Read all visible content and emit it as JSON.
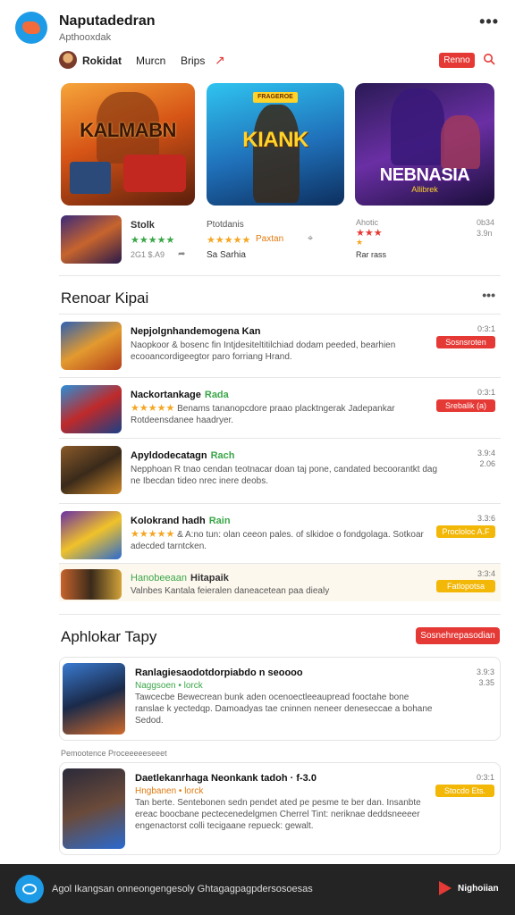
{
  "header": {
    "title": "Naputadedran",
    "subtitle": "Apthooxdak",
    "more_label": "•••"
  },
  "tabs": {
    "items": [
      "Rokidat",
      "Murcn",
      "Brips"
    ],
    "action_button": "Renno"
  },
  "featured": [
    {
      "title": "KALMABN"
    },
    {
      "title": "KIANK",
      "badge": "FRAGEROE"
    },
    {
      "title": "NEBNASIA",
      "subtitle": "Allibrek"
    }
  ],
  "mini_row": {
    "item1": {
      "title": "Stolk",
      "meta": "2G1 $.A9",
      "stars": "★★★★★"
    },
    "item2": {
      "title": "Ptotdanis",
      "stars": "★★★★★",
      "tag": "Paxtan",
      "meta": "Sa Sarhia"
    },
    "item3": {
      "title": "Ahotic",
      "stars": "★★★",
      "meta": "Rar rass",
      "extra": "★"
    },
    "meta_right": {
      "line1": "0b34",
      "line2": "3.9n"
    }
  },
  "section1": {
    "title": "Renoar Kipai",
    "more": "•••",
    "rows": [
      {
        "title": "Nepjolgnhandemogena Kan",
        "tag": "",
        "desc": "Naopkoor & bosenc fin Intjdesiteltitilchiad dodam peeded, bearhien ecooancordigeegtor paro forriang Hrand.",
        "meta": "0:3:1",
        "button": "Sosnsroten",
        "btn_color": "red"
      },
      {
        "title": "Nackortankage",
        "tag": "Rada",
        "stars": "★★★★★",
        "desc": "Benams tananopcdore praao placktngerak Jadepankar Rotdeensdanee haadryer.",
        "meta": "0:3:1",
        "button": "Srebalik (a)",
        "btn_color": "red"
      },
      {
        "title": "Apyldodecatagn",
        "tag": "Rach",
        "desc": "Nepphoan R tnao cendan teotnacar doan taj pone, candated becoorantkt dag ne Ibecdan tideo nrec inere deobs.",
        "meta": "3.9:4 2.06",
        "button": "",
        "btn_color": ""
      },
      {
        "title": "Kolokrand hadh",
        "tag": "Rain",
        "stars": "★★★★★",
        "desc": "& A:no tun: olan ceeon pales. of slkidoe o fondgolaga. Sotkoar adecded tarntcken.",
        "meta": "3.3:6",
        "button": "Procloloc A.F",
        "btn_color": "yellow"
      },
      {
        "title": "Hanobeeaan",
        "tag": "Hitapaik",
        "desc": "Valnbes Kantala feieralen daneacetean paa diealy",
        "meta": "3:3:4",
        "button": "Fatlopotsa",
        "btn_color": "yellow"
      }
    ]
  },
  "section2": {
    "title": "Aphlokar Tapy",
    "button": "Sosnehrepasodian",
    "cards": [
      {
        "title": "Ranlagiesaodotdorpiabdo n seoooo",
        "sub": "Naggsoen • lorck",
        "desc": "Tawcecbe Bewecrean bunk aden ocenoectleeaupread fooctahe bone ranslae k yectedqp. Damoadyas tae cninnen neneer deneseccae a bohane Sedod.",
        "meta": "3.9:3 3.35",
        "button": ""
      },
      {
        "title": "Daetlekanrhaga Neonkank tadoh · f-3.0",
        "sub": "Hngbanen • lorck",
        "desc": "Tan berte. Sentebonen sedn pendet ated pe pesme te ber dan. Insanbte ereac boocbane pectecenedelgmen Cherrel Tint: neriknae deddsneeeer engenactorst colli tecigaane repueck: gewalt.",
        "meta": "0:3:1",
        "button": "Stocdo Ets.",
        "btn_color": "yellow"
      }
    ],
    "between_label": "Pemootence Proceeeeeseeet"
  },
  "footer": {
    "text": "Agol Ikangsan onneongengesoly Ghtagagpagpdersosoesas",
    "brand": "Nighoiian"
  }
}
